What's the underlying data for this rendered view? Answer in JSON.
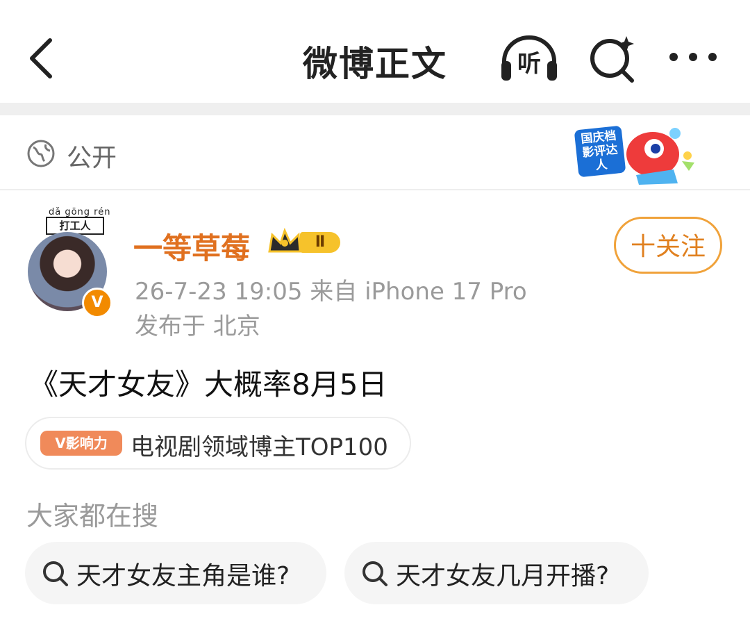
{
  "header": {
    "title": "微博正文",
    "listen_label": "听",
    "icons": [
      "back-arrow-icon",
      "headphones-icon",
      "ai-search-icon",
      "more-dots-icon"
    ]
  },
  "visibility": {
    "label": "公开",
    "icon": "globe-icon",
    "promo_badge": "国庆档影评达人"
  },
  "author": {
    "avatar_frame_pinyin": "dǎ gōng rén",
    "avatar_frame_text": "打工人",
    "name": "一等草莓",
    "level": "Ⅱ",
    "verified_mark": "V",
    "time_source": "26-7-23 19:05  来自 iPhone 17 Pro",
    "location": "发布于 北京",
    "follow_label": "十关注"
  },
  "post": {
    "text": "《天才女友》大概率8月5日",
    "influence_tag": "V影响力",
    "influence_text": "电视剧领域博主TOP100"
  },
  "hot_search": {
    "title": "大家都在搜",
    "items": [
      "天才女友主角是谁?",
      "天才女友几月开播?"
    ]
  },
  "colors": {
    "accent_orange": "#e0701f",
    "follow_border": "#f0a23a",
    "gray_text": "#9a9a9a"
  }
}
